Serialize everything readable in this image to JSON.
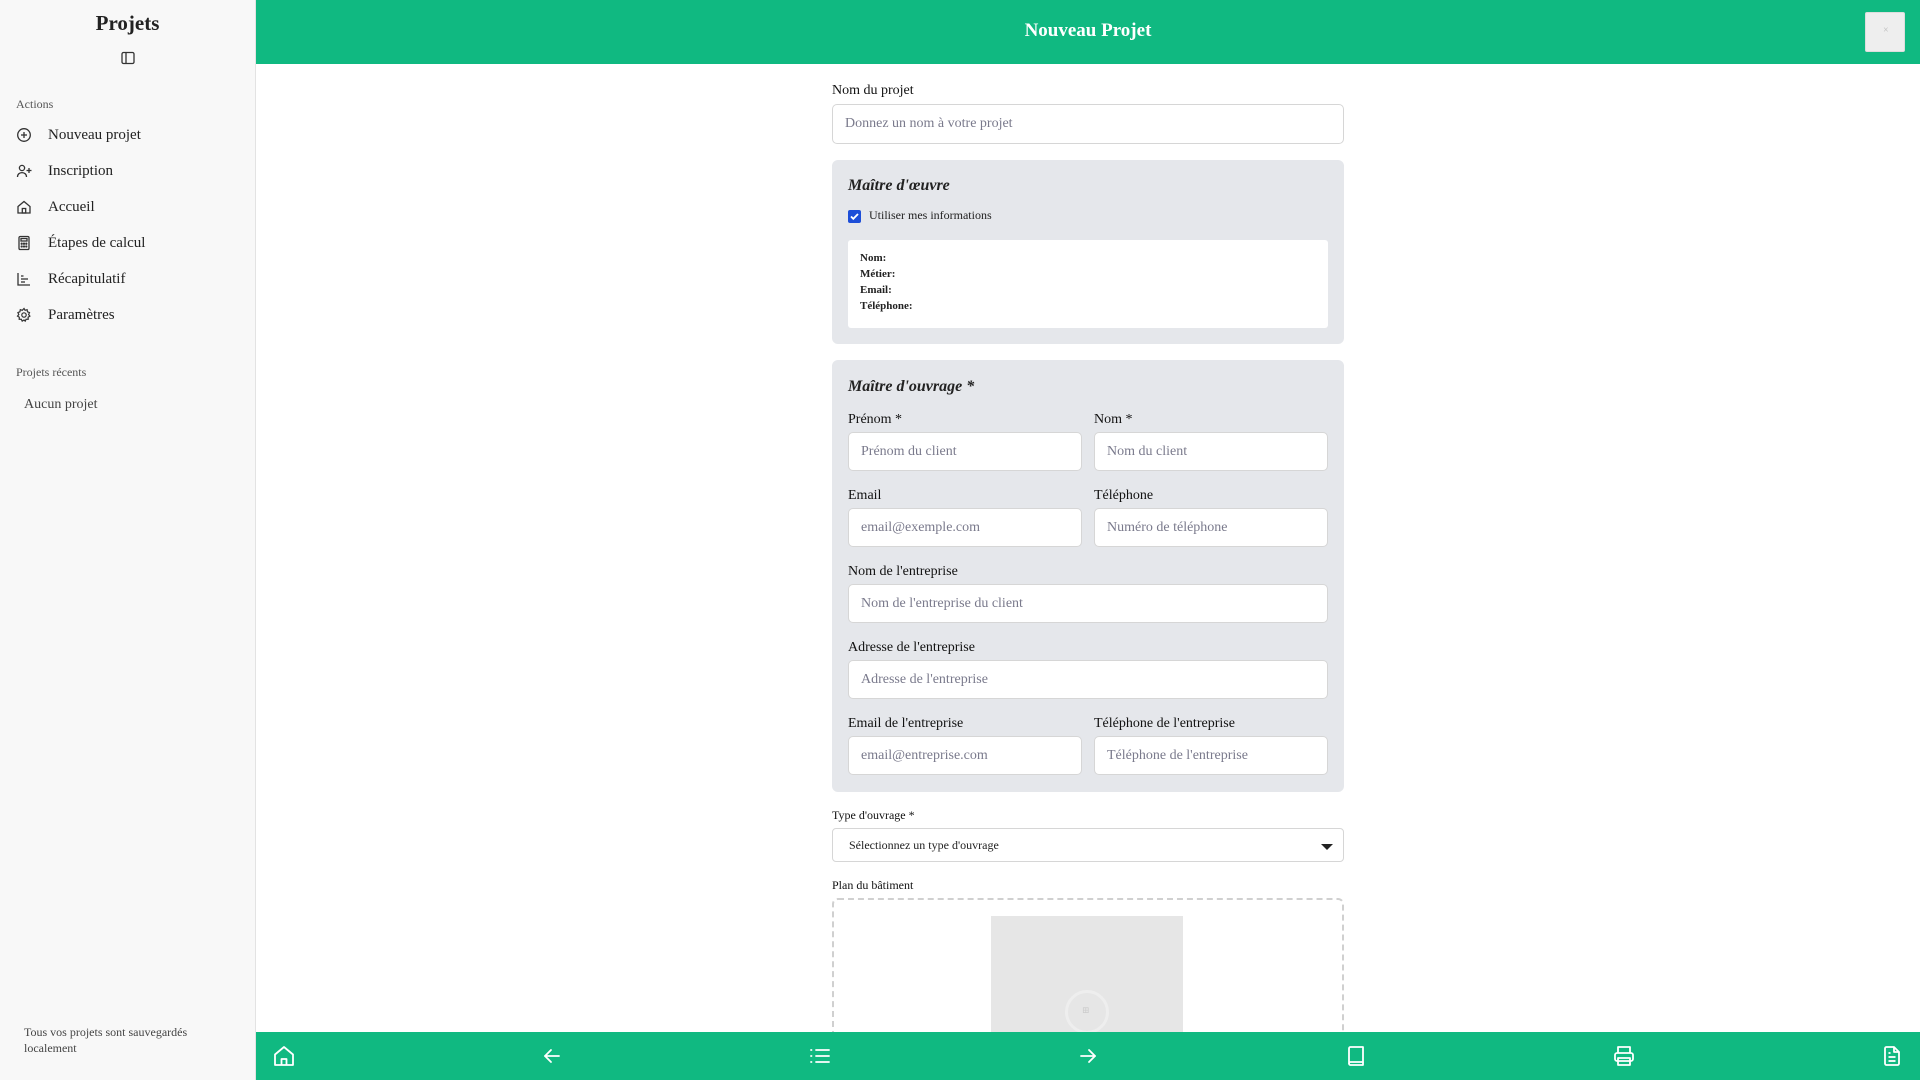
{
  "sidebar": {
    "title": "Projets",
    "toggle_icon": "sidebar-toggle-icon",
    "actions_label": "Actions",
    "items": [
      {
        "label": "Nouveau projet",
        "icon": "plus-circle-icon"
      },
      {
        "label": "Inscription",
        "icon": "user-plus-icon"
      },
      {
        "label": "Accueil",
        "icon": "home-icon"
      },
      {
        "label": "Étapes de calcul",
        "icon": "calculator-icon"
      },
      {
        "label": "Récapitulatif",
        "icon": "bar-chart-icon"
      },
      {
        "label": "Paramètres",
        "icon": "gear-icon"
      }
    ],
    "recent_label": "Projets récents",
    "recent_empty": "Aucun projet",
    "footer": "Tous vos projets sont sauvegardés localement"
  },
  "header": {
    "title": "Nouveau Projet",
    "accent": "#10b981"
  },
  "form": {
    "project_name": {
      "label": "Nom du projet",
      "placeholder": "Donnez un nom à votre projet",
      "value": ""
    },
    "maitre_oeuvre": {
      "title": "Maître d'œuvre",
      "use_my_info_label": "Utiliser mes informations",
      "use_my_info_checked": true,
      "info_lines": [
        "Nom:",
        "Métier:",
        "Email:",
        "Téléphone:"
      ]
    },
    "maitre_ouvrage": {
      "title": "Maître d'ouvrage *",
      "first_name": {
        "label": "Prénom *",
        "placeholder": "Prénom du client"
      },
      "last_name": {
        "label": "Nom *",
        "placeholder": "Nom du client"
      },
      "email": {
        "label": "Email",
        "placeholder": "email@exemple.com"
      },
      "phone": {
        "label": "Téléphone",
        "placeholder": "Numéro de téléphone"
      },
      "company_name": {
        "label": "Nom de l'entreprise",
        "placeholder": "Nom de l'entreprise du client"
      },
      "company_address": {
        "label": "Adresse de l'entreprise",
        "placeholder": "Adresse de l'entreprise"
      },
      "company_email": {
        "label": "Email de l'entreprise",
        "placeholder": "email@entreprise.com"
      },
      "company_phone": {
        "label": "Téléphone de l'entreprise",
        "placeholder": "Téléphone de l'entreprise"
      }
    },
    "type_ouvrage": {
      "label": "Type d'ouvrage *",
      "selected": "Sélectionnez un type d'ouvrage"
    },
    "plan": {
      "label": "Plan du bâtiment"
    }
  },
  "bottombar": {
    "icons": [
      "home-icon",
      "arrow-left-icon",
      "list-icon",
      "arrow-right-icon",
      "book-icon",
      "printer-icon",
      "document-icon"
    ]
  }
}
